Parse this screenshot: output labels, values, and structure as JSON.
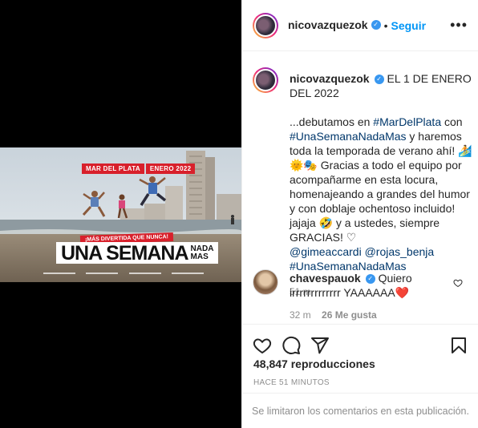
{
  "post_media": {
    "tags": [
      "MAR DEL PLATA",
      "ENERO 2022"
    ],
    "promo": "¡MÁS DIVERTIDA QUE NUNCA!",
    "film_title_main": "UNA SEMANA",
    "film_title_small": [
      "NADA",
      "MAS"
    ]
  },
  "header": {
    "username": "nicovazquezok",
    "follow_label": "Seguir",
    "more_icon": "more-horizontal-icon"
  },
  "caption": {
    "username": "nicovazquezok",
    "line1": "EL 1 DE ENERO DEL 2022",
    "t1": "...debutamos en ",
    "tag1": "#MarDelPlata",
    "t2": " con ",
    "tag2": "#UnaSemanaNadaMas",
    "t3": " y haremos toda la temporada de verano ahí! ",
    "emojis1": "🏄🌞🎭",
    "t4": " Gracias a todo el equipo por acompañarme en esta locura, homenajeando a grandes del humor y con doblaje ochentoso incluido! jajaja ",
    "emoji2": "🤣",
    "t5": " y a ustedes, siempre GRACIAS! ",
    "emoji3": "♡",
    "mention1": "@gimeaccardi",
    "mention2": "@rojas_benja",
    "tag3": "#UnaSemanaNadaMas",
    "time": "51 m"
  },
  "comment": {
    "username": "chavespauok",
    "text": "Quiero irrrrrrrrrrrrr YAAAAAA",
    "emoji": "❤️",
    "time": "32 m",
    "likes": "26 Me gusta"
  },
  "actions": {
    "icons": [
      "heart-icon",
      "comment-icon",
      "share-icon",
      "bookmark-icon"
    ]
  },
  "views": "48,847 reproducciones",
  "posted_ago": "HACE 51 MINUTOS",
  "comments_limited": "Se limitaron los comentarios en esta publicación.",
  "colors": {
    "link": "#00376b",
    "follow": "#0095f6",
    "verified": "#3897f0",
    "muted": "#8e8e8e",
    "brand_red": "#d8202b"
  }
}
